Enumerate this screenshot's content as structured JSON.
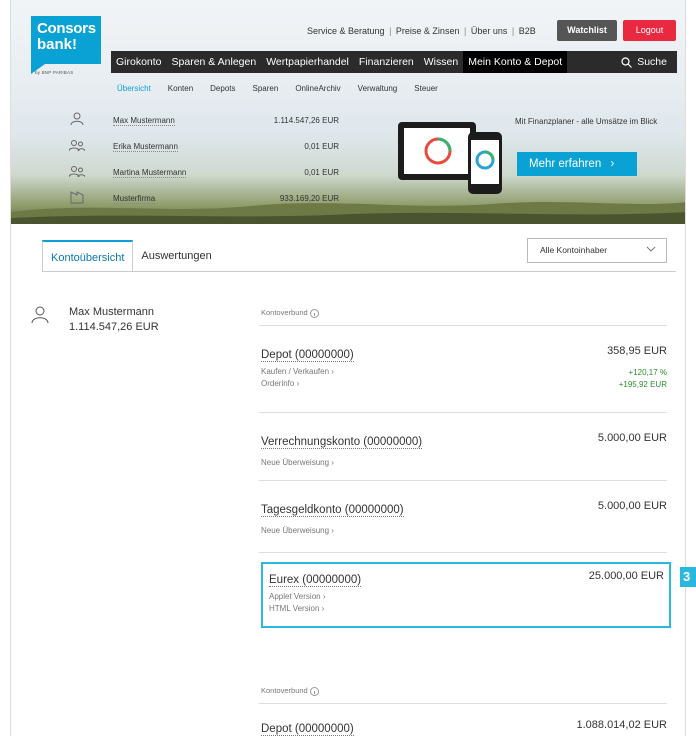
{
  "logo": {
    "line1": "Consors",
    "line2": "bank!",
    "sub": "by BNP PARIBAS"
  },
  "service_links": [
    "Service & Beratung",
    "Preise & Zinsen",
    "Über uns",
    "B2B"
  ],
  "buttons": {
    "watchlist": "Watchlist",
    "logout": "Logout",
    "promo": "Mehr erfahren"
  },
  "main_nav": [
    "Girokonto",
    "Sparen & Anlegen",
    "Wertpapierhandel",
    "Finanzieren",
    "Wissen",
    "Mein Konto & Depot"
  ],
  "search_label": "Suche",
  "sub_nav": [
    "Übersicht",
    "Konten",
    "Depots",
    "Sparen",
    "OnlineArchiv",
    "Verwaltung",
    "Steuer"
  ],
  "owners": [
    {
      "name": "Max Mustermann",
      "amount": "1.114.547,26 EUR",
      "icon": "person-icon"
    },
    {
      "name": "Erika Mustermann",
      "amount": "0,01 EUR",
      "icon": "persons-icon"
    },
    {
      "name": "Martina Mustermann",
      "amount": "0,01 EUR",
      "icon": "persons-icon"
    },
    {
      "name": "Musterfirma",
      "amount": "933.169,20 EUR",
      "icon": "company-icon"
    }
  ],
  "promo_text": "Mit Finanzplaner - alle Umsätze im Blick",
  "tabs": [
    "Kontoübersicht",
    "Auswertungen"
  ],
  "owner_select": "Alle Kontoinhaber",
  "person": {
    "name": "Max Mustermann",
    "total": "1.114.547,26 EUR"
  },
  "group_label": "Kontoverbund",
  "accounts": [
    {
      "title": "Depot (00000000)",
      "amount": "358,95 EUR",
      "links": [
        "Kaufen / Verkaufen",
        "Orderinfo"
      ],
      "gain_pct": "+120,17 %",
      "gain_abs": "+195,92 EUR"
    },
    {
      "title": "Verrechnungskonto (00000000)",
      "amount": "5.000,00 EUR",
      "links": [
        "Neue Überweisung"
      ]
    },
    {
      "title": "Tagesgeldkonto (00000000)",
      "amount": "5.000,00 EUR",
      "links": [
        "Neue Überweisung"
      ]
    },
    {
      "title": "Eurex (00000000)",
      "amount": "25.000,00 EUR",
      "links": [
        "Applet Version",
        "HTML Version"
      ]
    }
  ],
  "second_group": {
    "label": "Kontoverbund",
    "title": "Depot (00000000)",
    "amount": "1.088.014,02 EUR"
  },
  "badge": "3",
  "colors": {
    "brand": "#0aa1d4",
    "logout": "#e8293f",
    "gain": "#2e8b2e",
    "highlight": "#2ab7e0"
  }
}
